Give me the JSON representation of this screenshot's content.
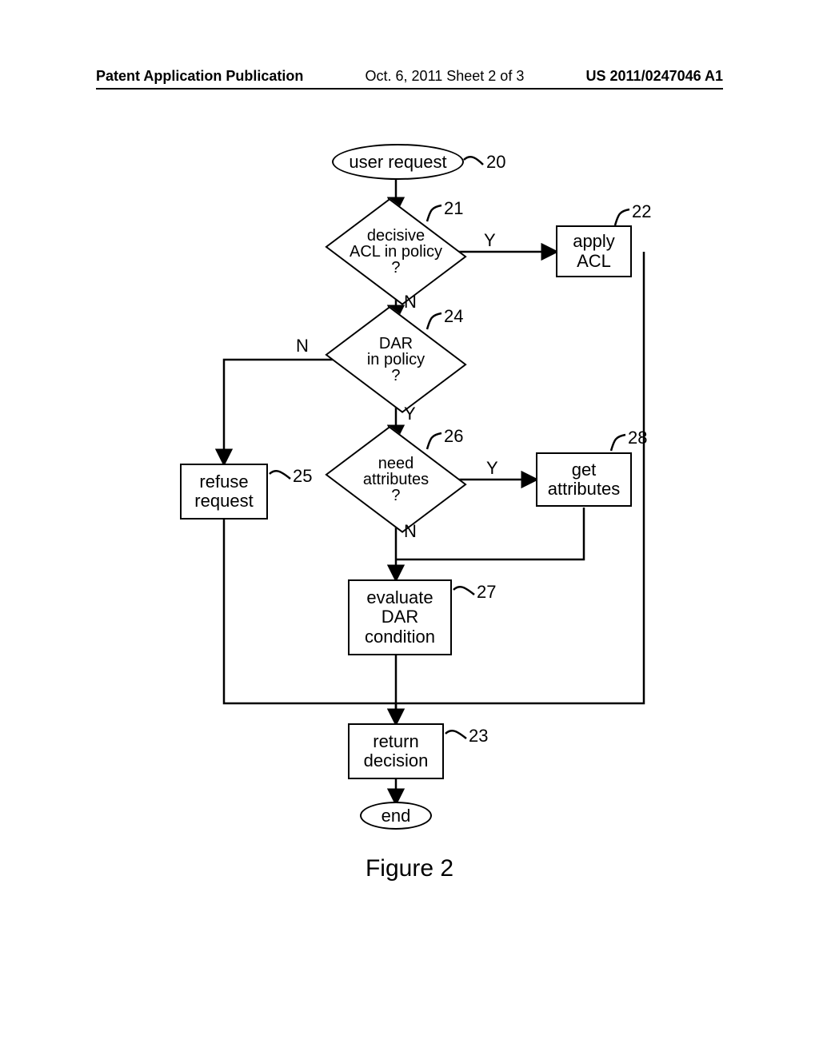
{
  "header": {
    "left": "Patent Application Publication",
    "mid": "Oct. 6, 2011   Sheet 2 of 3",
    "right": "US 2011/0247046 A1"
  },
  "figure_caption": "Figure 2",
  "nodes": {
    "start": "user request",
    "d21": "decisive\nACL in policy\n?",
    "p22": "apply\nACL",
    "d24": "DAR\nin policy\n?",
    "p25": "refuse\nrequest",
    "d26": "need\nattributes\n?",
    "p28": "get\nattributes",
    "p27": "evaluate\nDAR\ncondition",
    "p23": "return\ndecision",
    "end": "end"
  },
  "refs": {
    "r20": "20",
    "r21": "21",
    "r22": "22",
    "r24": "24",
    "r25": "25",
    "r26": "26",
    "r28": "28",
    "r27": "27",
    "r23": "23"
  },
  "labels": {
    "y": "Y",
    "n": "N"
  }
}
